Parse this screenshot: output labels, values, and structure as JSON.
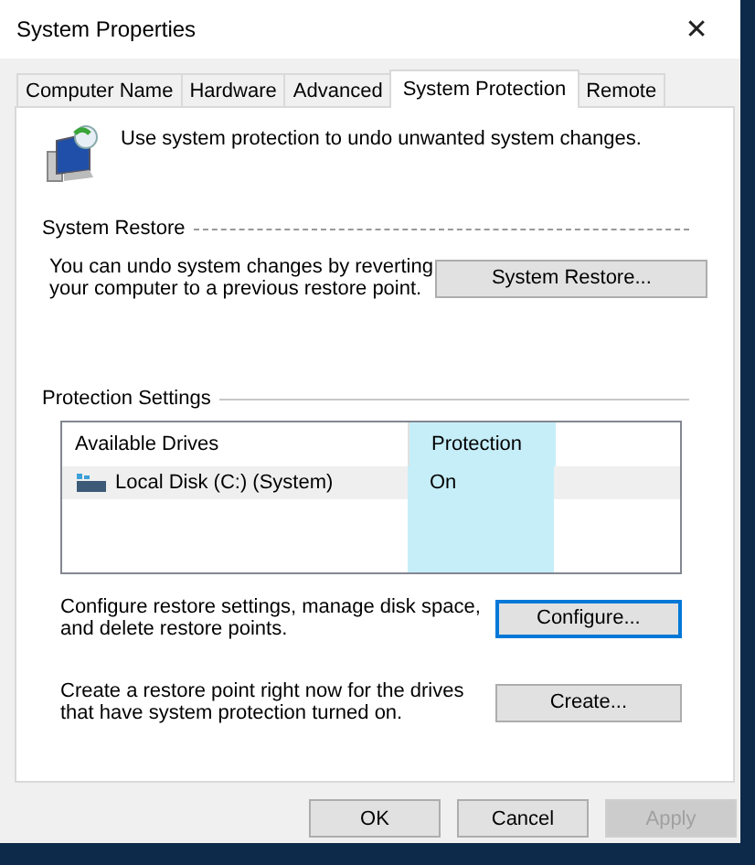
{
  "window": {
    "title": "System Properties",
    "close": "✕"
  },
  "tabs": [
    {
      "label": "Computer Name",
      "selected": false
    },
    {
      "label": "Hardware",
      "selected": false
    },
    {
      "label": "Advanced",
      "selected": false
    },
    {
      "label": "System Protection",
      "selected": true
    },
    {
      "label": "Remote",
      "selected": false
    }
  ],
  "intro": "Use system protection to undo unwanted system changes.",
  "system_restore": {
    "heading": "System Restore",
    "text": "You can undo system changes by reverting your computer to a previous restore point.",
    "button": {
      "label": "System Restore..."
    }
  },
  "protection_settings": {
    "heading": "Protection Settings",
    "columns": [
      {
        "label": "Available Drives",
        "highlighted": false
      },
      {
        "label": "Protection",
        "highlighted": true
      }
    ],
    "rows": [
      {
        "drive": "Local Disk (C:) (System)",
        "protection": "On",
        "selected": true
      }
    ],
    "actions": [
      {
        "text": "Configure restore settings, manage disk space, and delete restore points.",
        "button": {
          "label": "Configure...",
          "focused": true
        }
      },
      {
        "text": "Create a restore point right now for the drives that have system protection turned on.",
        "button": {
          "label": "Create...",
          "focused": false
        }
      }
    ]
  },
  "buttons": [
    {
      "label": "OK",
      "disabled": false
    },
    {
      "label": "Cancel",
      "disabled": false
    },
    {
      "label": "Apply",
      "disabled": true
    }
  ]
}
